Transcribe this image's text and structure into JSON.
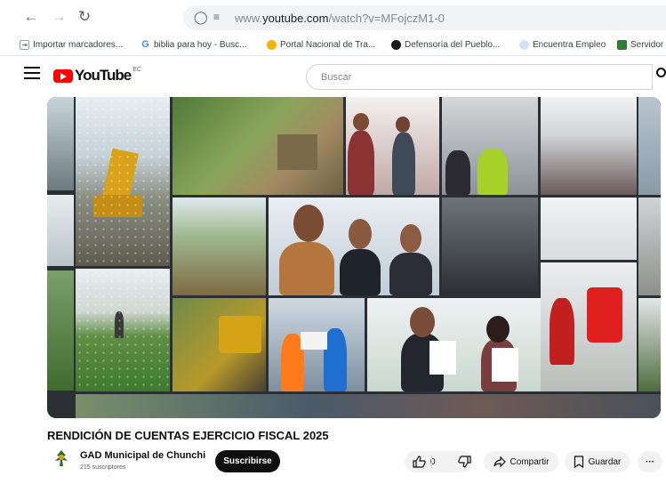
{
  "browser": {
    "url_prefix": "www.",
    "url_domain": "youtube.com",
    "url_path": "/watch?v=MFojczM1-0"
  },
  "bookmarks": [
    {
      "label": "Importar marcadores...",
      "icon": "import-icon"
    },
    {
      "label": "biblia para hoy - Busc...",
      "icon": "google-icon"
    },
    {
      "label": "Portal Nacional de Tra...",
      "icon": "portal-icon"
    },
    {
      "label": "Defensoría del Pueblo...",
      "icon": "defensoria-icon"
    },
    {
      "label": "Encuentra Empleo",
      "icon": "empleo-icon"
    },
    {
      "label": "Servidor",
      "icon": "servidor-icon"
    }
  ],
  "youtube": {
    "logo_text": "YouTube",
    "logo_country": "EC",
    "search_placeholder": "Buscar"
  },
  "video": {
    "title": "RENDICIÓN DE CUENTAS EJERCICIO FISCAL 2025",
    "channel_name": "GAD Municipal de Chunchi",
    "subscribers": "215 suscriptores",
    "subscribe_label": "Suscribirse",
    "likes": "0",
    "share_label": "Compartir",
    "save_label": "Guardar",
    "more_label": "···"
  },
  "colors": {
    "youtube_red": "#ff0000",
    "subscribe_bg": "#0f0f0f",
    "pill_bg": "#f2f2f2"
  }
}
